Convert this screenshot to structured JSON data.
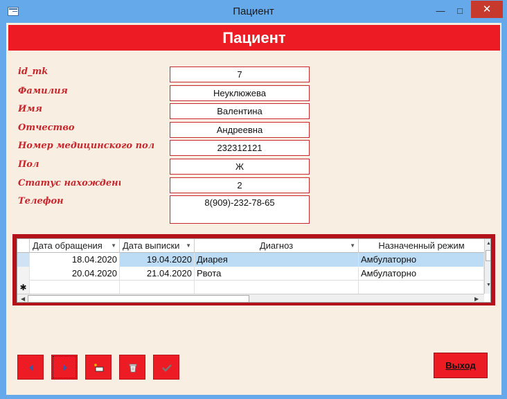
{
  "window": {
    "title": "Пациент",
    "minimize": "—",
    "maximize": "□",
    "close": "✕"
  },
  "form": {
    "header": "Пациент"
  },
  "fields": [
    {
      "label": "id_mk",
      "value": "7"
    },
    {
      "label": "Фамилия",
      "value": "Неуклюжева"
    },
    {
      "label": "Имя",
      "value": "Валентина"
    },
    {
      "label": "Отчество",
      "value": "Андреевна"
    },
    {
      "label": "Номер медицинского полиса",
      "value": "232312121"
    },
    {
      "label": "Пол",
      "value": "Ж"
    },
    {
      "label": "Статус нахождения",
      "value": "2"
    },
    {
      "label": "Телефон",
      "value": "8(909)-232-78-65"
    }
  ],
  "grid": {
    "columns": [
      "Дата обращения",
      "Дата выписки",
      "Диагноз",
      "Назначенный режим"
    ],
    "rows": [
      [
        "18.04.2020",
        "19.04.2020",
        "Диарея",
        "Амбулаторно"
      ],
      [
        "20.04.2020",
        "21.04.2020",
        "Рвота",
        "Амбулаторно"
      ]
    ],
    "new_row_marker": "✱",
    "sort_arrow": "▼"
  },
  "buttons": {
    "prev": "prev-record-icon",
    "next": "next-record-icon",
    "new": "new-record-icon",
    "delete": "delete-record-icon",
    "save": "save-record-icon",
    "exit": "Выход"
  },
  "colors": {
    "accent": "#ed1c24",
    "label": "#c8282d",
    "background": "#f8eee2",
    "titlebar": "#66a9ea"
  }
}
